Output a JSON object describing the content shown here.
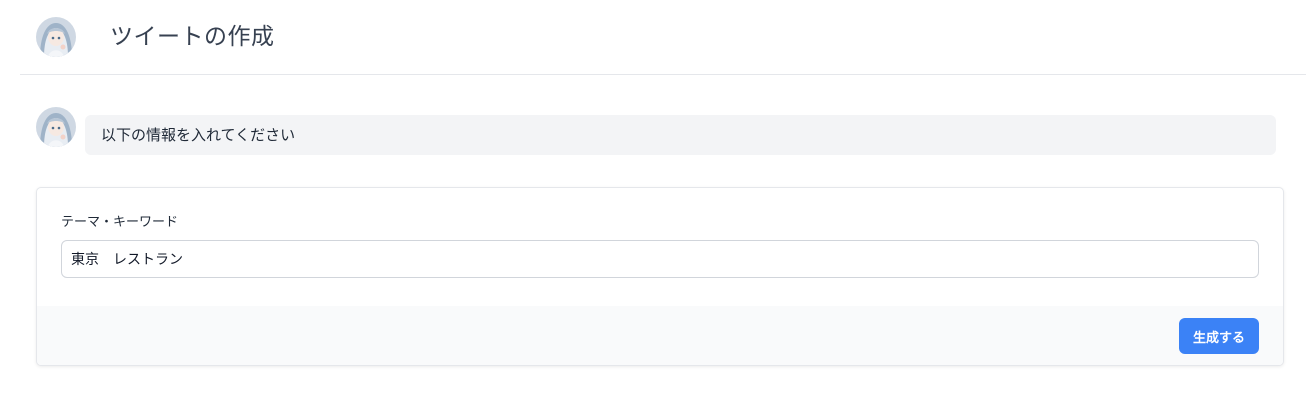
{
  "header": {
    "title": "ツイートの作成",
    "avatar_icon": "anime-character-avatar-icon"
  },
  "message": {
    "avatar_icon": "anime-character-avatar-icon",
    "text": "以下の情報を入れてください"
  },
  "form": {
    "field_label": "テーマ・キーワード",
    "field_value": "東京　レストラン",
    "submit_label": "生成する"
  },
  "colors": {
    "accent": "#3b82f6",
    "bubble_bg": "#f3f4f6",
    "footer_bg": "#f9fafb",
    "border": "#e5e7eb"
  }
}
